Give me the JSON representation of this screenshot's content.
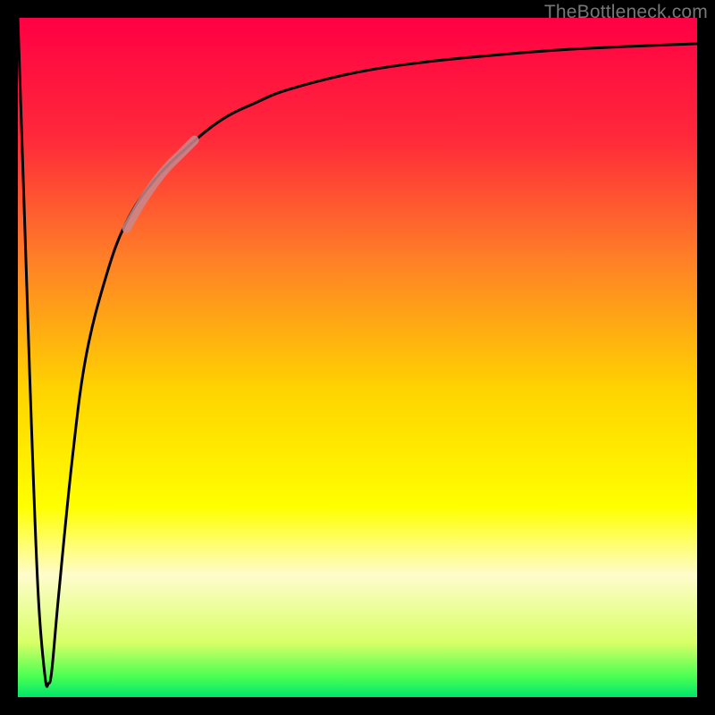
{
  "watermark": "TheBottleneck.com",
  "chart_data": {
    "type": "line",
    "title": "",
    "xlabel": "",
    "ylabel": "",
    "xlim": [
      0,
      100
    ],
    "ylim": [
      0,
      100
    ],
    "grid": false,
    "legend": false,
    "background_gradient": {
      "stops": [
        {
          "pos": 0.0,
          "color": "#ff0044"
        },
        {
          "pos": 0.18,
          "color": "#ff2a3a"
        },
        {
          "pos": 0.35,
          "color": "#ff7d28"
        },
        {
          "pos": 0.55,
          "color": "#ffd400"
        },
        {
          "pos": 0.72,
          "color": "#ffff00"
        },
        {
          "pos": 0.82,
          "color": "#fffccc"
        },
        {
          "pos": 0.92,
          "color": "#d8ff66"
        },
        {
          "pos": 0.97,
          "color": "#49ff53"
        },
        {
          "pos": 1.0,
          "color": "#00e66b"
        }
      ]
    },
    "series": [
      {
        "name": "bottleneck-curve",
        "color": "#000000",
        "x": [
          0,
          1,
          2,
          3,
          4,
          4.5,
          5,
          6,
          8,
          10,
          13,
          16,
          20,
          25,
          30,
          35,
          40,
          50,
          60,
          70,
          80,
          90,
          100
        ],
        "y": [
          100,
          70,
          40,
          15,
          3,
          2,
          4,
          15,
          35,
          50,
          62,
          70,
          76,
          81,
          85,
          87.5,
          89.5,
          92,
          93.5,
          94.5,
          95.3,
          95.8,
          96.2
        ]
      },
      {
        "name": "highlight-segment",
        "color": "#c9888d",
        "x": [
          16,
          18,
          20,
          22,
          24,
          26
        ],
        "y": [
          69,
          72.5,
          75.5,
          78,
          80,
          82
        ]
      }
    ],
    "annotations": []
  }
}
